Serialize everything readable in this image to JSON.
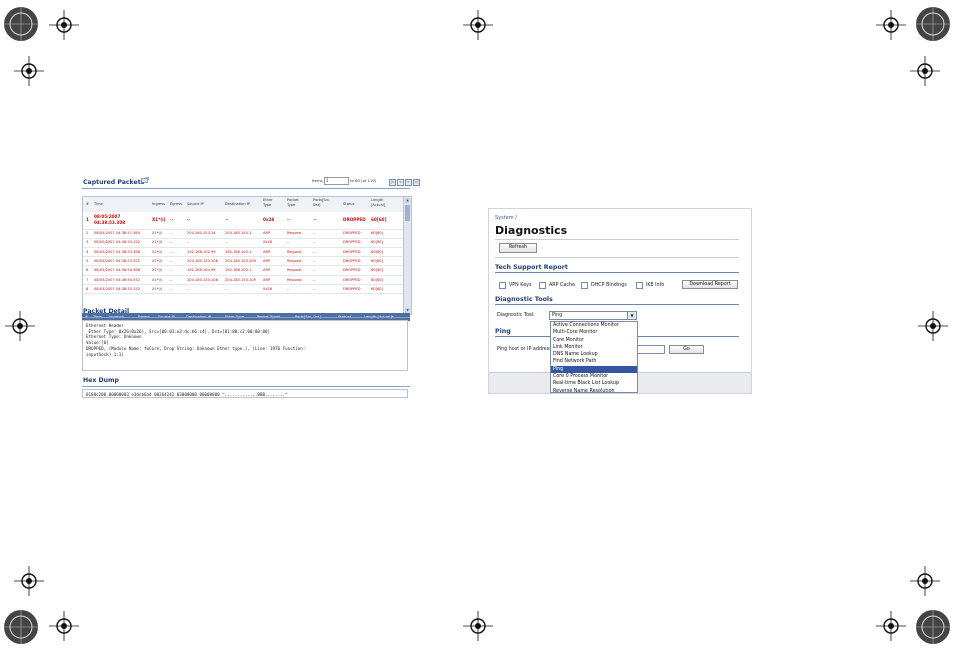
{
  "captured_packets": {
    "title": "Captured Packets",
    "items_label": "Items",
    "items_value": "1",
    "items_range": "to 80 (of 119)",
    "pager": [
      "|<",
      "<",
      ">",
      ">|"
    ],
    "columns": [
      "#",
      "Time",
      "Ingress",
      "Egress",
      "Source IP",
      "Destination IP",
      "Ether Type",
      "Packet Type",
      "Ports[Src, Dst]",
      "Status",
      "Length [Actual]"
    ],
    "rows": [
      {
        "n": "1",
        "time": "08/05/2007 04:38:53.308",
        "ingress": "X1*(i)",
        "egress": "--",
        "src": "--",
        "dst": "--",
        "ether": "0x26",
        "ptype": "--",
        "ports": "--",
        "status": "DROPPED",
        "len": "60[60]"
      },
      {
        "n": "2",
        "time": "08/05/2007 04:38:51.364",
        "ingress": "X1*(i)",
        "egress": "--",
        "src": "204.180.153.24",
        "dst": "204.180.153.1",
        "ether": "ARP",
        "ptype": "Request",
        "ports": "--",
        "status": "DROPPED",
        "len": "60[60]"
      },
      {
        "n": "3",
        "time": "08/05/2007 04:38:53.152",
        "ingress": "X1*(i)",
        "egress": "--",
        "src": "--",
        "dst": "--",
        "ether": "0x26",
        "ptype": "--",
        "ports": "--",
        "status": "DROPPED",
        "len": "60[60]"
      },
      {
        "n": "4",
        "time": "08/05/2007 04:38:53.368",
        "ingress": "X1*(i)",
        "egress": "--",
        "src": "192.168.100.99",
        "dst": "192.168.100.1",
        "ether": "ARP",
        "ptype": "Request",
        "ports": "--",
        "status": "DROPPED",
        "len": "60[60]"
      },
      {
        "n": "5",
        "time": "08/05/2007 04:38:53.552",
        "ingress": "X1*(i)",
        "egress": "--",
        "src": "204.180.153.108",
        "dst": "204.180.153.109",
        "ether": "ARP",
        "ptype": "Request",
        "ports": "--",
        "status": "DROPPED",
        "len": "60[60]"
      },
      {
        "n": "6",
        "time": "08/05/2007 04:38:54.368",
        "ingress": "X1*(i)",
        "egress": "--",
        "src": "192.168.100.99",
        "dst": "192.168.100.1",
        "ether": "ARP",
        "ptype": "Request",
        "ports": "--",
        "status": "DROPPED",
        "len": "60[60]"
      },
      {
        "n": "7",
        "time": "08/05/2007 04:38:54.552",
        "ingress": "X1*(i)",
        "egress": "--",
        "src": "204.180.153.108",
        "dst": "204.180.153.109",
        "ether": "ARP",
        "ptype": "Request",
        "ports": "--",
        "status": "DROPPED",
        "len": "60[60]"
      },
      {
        "n": "8",
        "time": "08/05/2007 04:38:55.152",
        "ingress": "X1*(i)",
        "egress": "--",
        "src": "--",
        "dst": "--",
        "ether": "0x26",
        "ptype": "--",
        "ports": "--",
        "status": "DROPPED",
        "len": "60[60]"
      }
    ],
    "footer": [
      "#",
      "Time",
      "Ingress*",
      "Egress",
      "Source IP",
      "Destination IP",
      "Ether Type",
      "Packet Type*",
      "Ports[Src, Dst]",
      "Status*",
      "Length [Actual]*"
    ]
  },
  "packet_detail": {
    "title": "Packet Detail",
    "lines": [
      "Ethernet Header",
      " Ether Type: 0x26(0x26), Src=[00:03:e3:dc:b6:c4], Dst=[01:80:c2:00:00:00]",
      "Ethernet Type: Unknown",
      "Value:[0]",
      "DROPPED, (Module Name: fwCore, Drop String: Unknown Ether type.), (Line: 1976 Function:",
      "inputSock) 1:1)"
    ]
  },
  "hex_dump": {
    "title": "Hex Dump",
    "line": "0180c200 00000003 e3dcb6a4 00264242 03000000 00008000 ^.............BBB........^"
  },
  "diagnostics": {
    "breadcrumb": "System /",
    "title": "Diagnostics",
    "refresh_label": "Refresh",
    "tech_support_title": "Tech Support Report",
    "checkboxes": [
      "VPN Keys",
      "ARP Cache",
      "DHCP Bindings",
      "IKE Info"
    ],
    "download_label": "Download Report",
    "tools_title": "Diagnostic Tools",
    "tool_label": "Diagnostic Tool:",
    "tool_value": "Ping",
    "ping_title": "Ping",
    "ping_label": "Ping host or IP address:",
    "go_label": "Go",
    "options": [
      "Active Connections Monitor",
      "Multi-Core Monitor",
      "Core Monitor",
      "Link Monitor",
      "DNS Name Lookup",
      "Find Network Path",
      "Ping",
      "Core 0 Process Monitor",
      "Real-time Black List Lookup",
      "Reverse Name Resolution"
    ],
    "selected_option": "Ping"
  }
}
